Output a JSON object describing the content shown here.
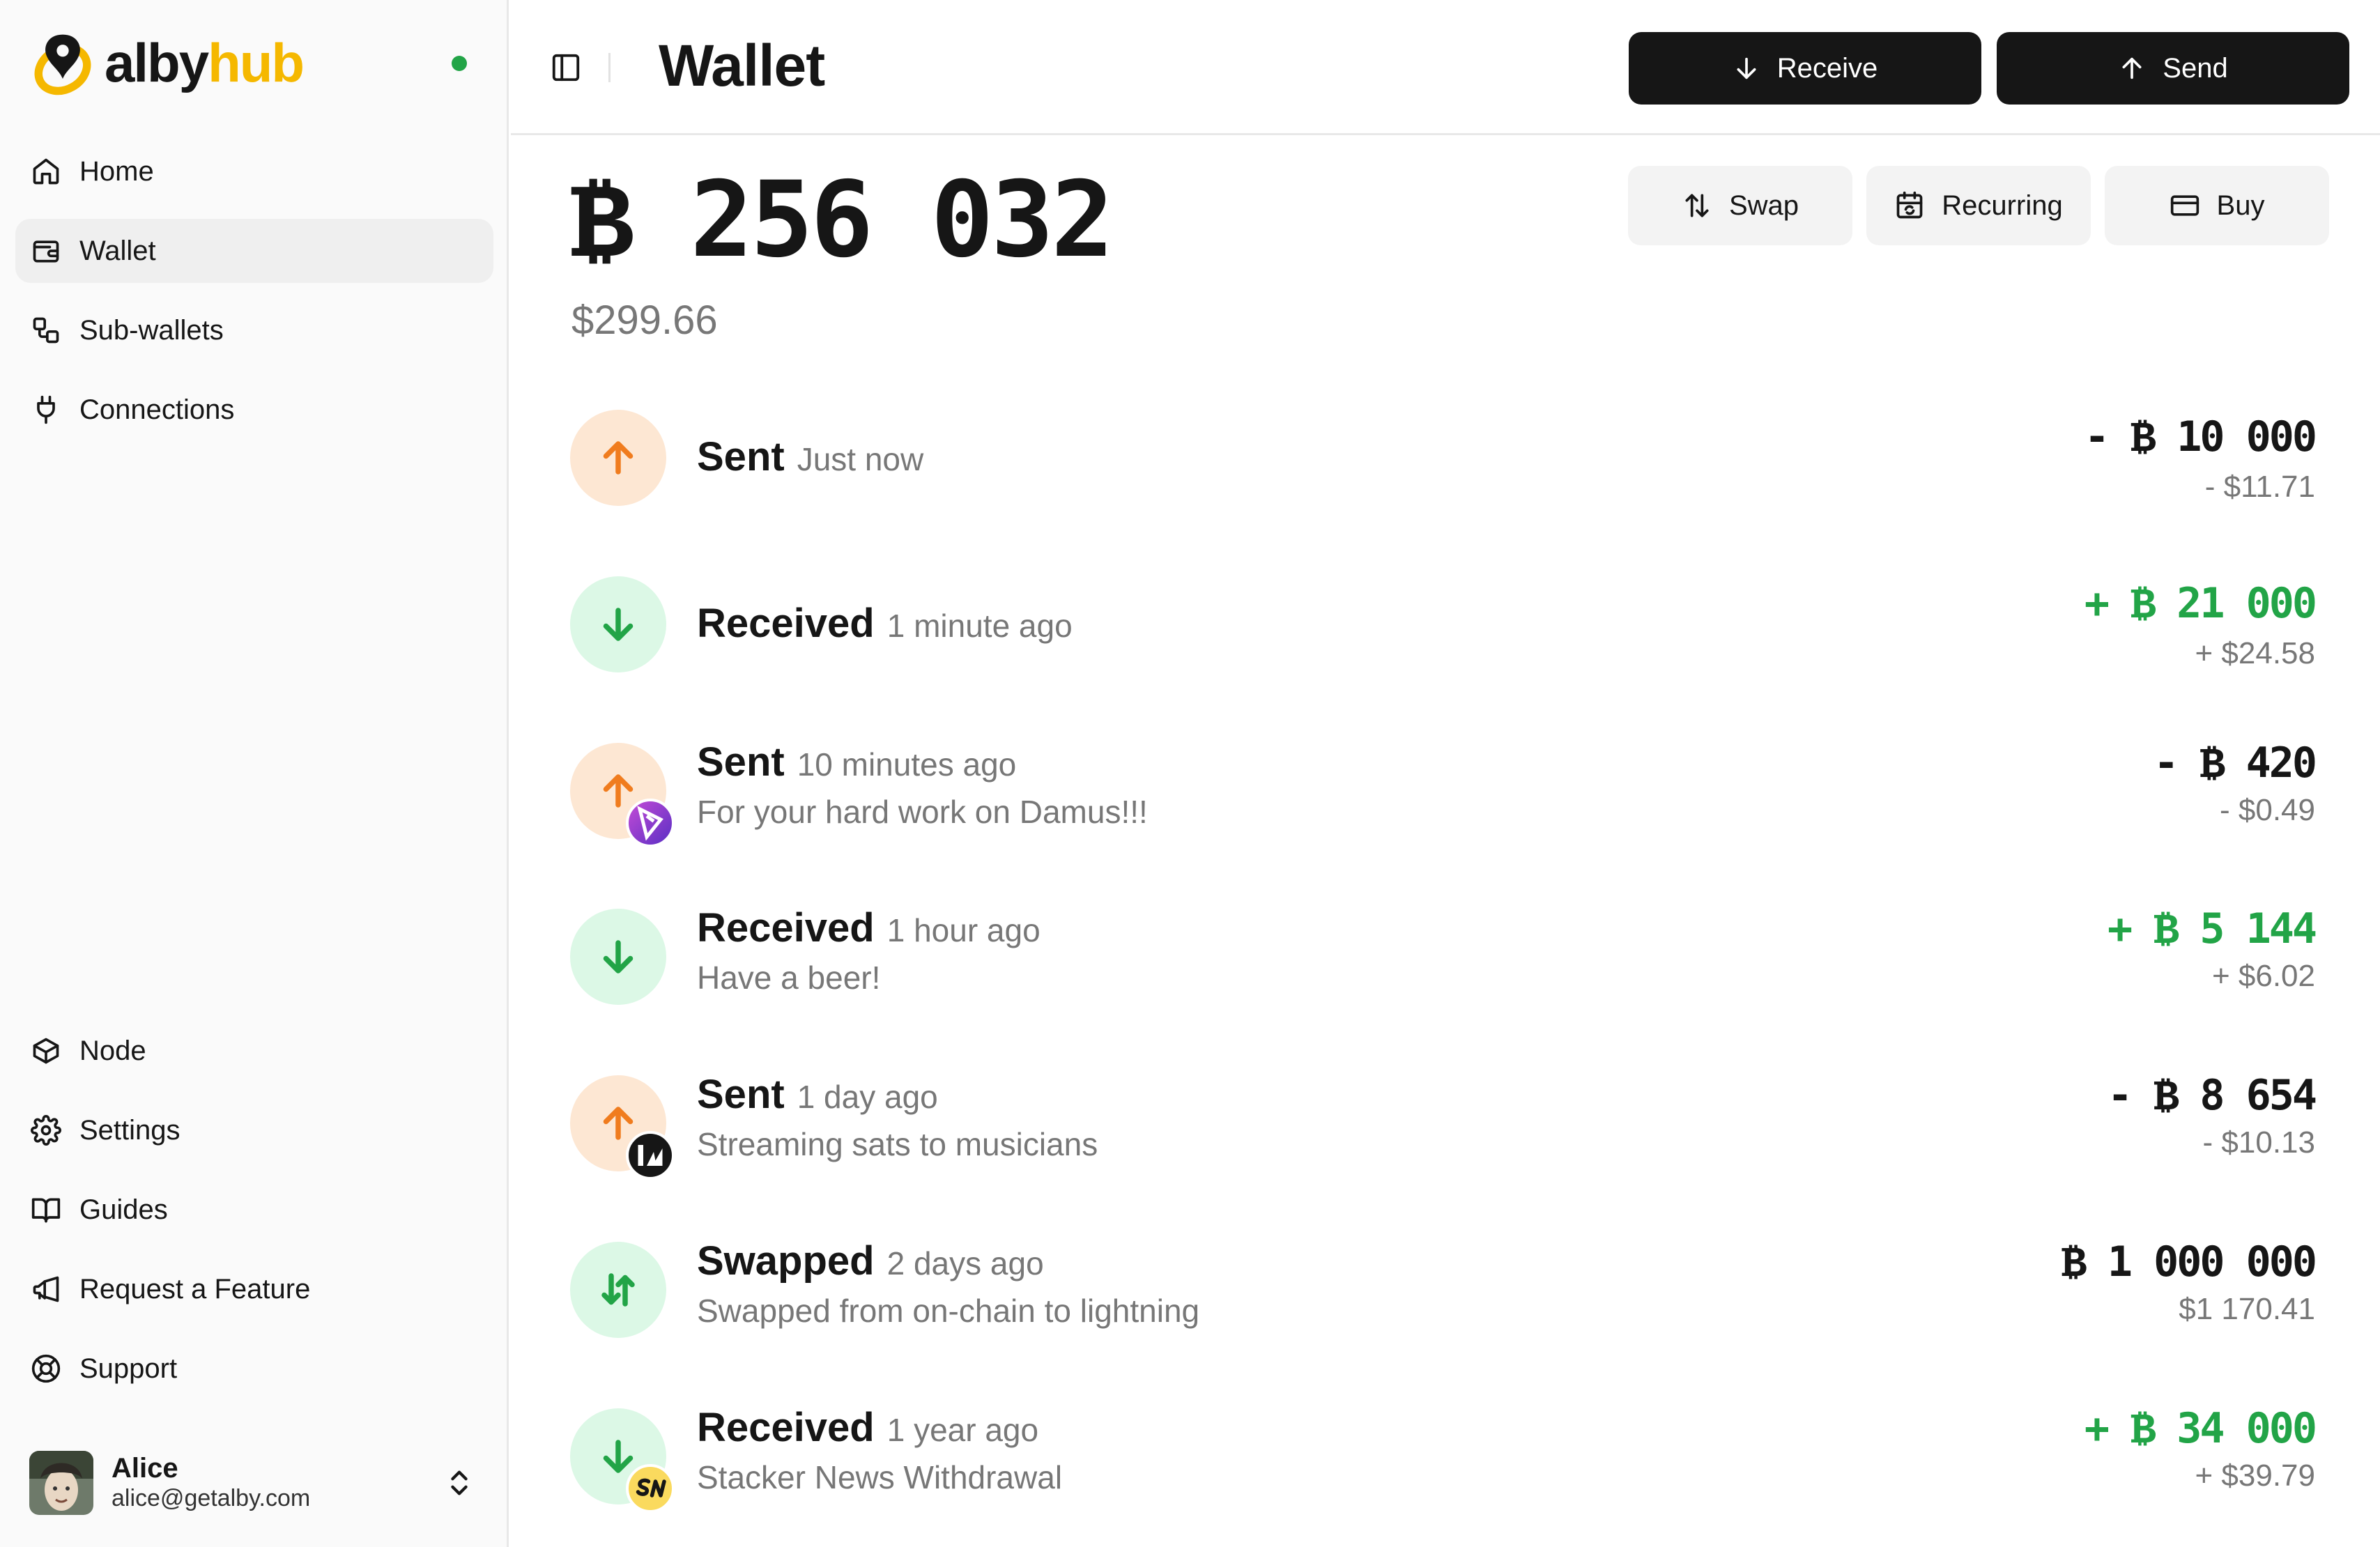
{
  "app": {
    "brand_part1": "alby",
    "brand_part2": "hub"
  },
  "colors": {
    "brand": "#f5b800",
    "positive": "#22a447",
    "sent_bg": "#fde7d3",
    "received_bg": "#dcf8e6",
    "sent_arrow": "#f07c1e"
  },
  "sidebar": {
    "top_items": [
      {
        "label": "Home",
        "icon": "home-icon"
      },
      {
        "label": "Wallet",
        "icon": "wallet-icon",
        "active": true
      },
      {
        "label": "Sub-wallets",
        "icon": "sub-wallets-icon"
      },
      {
        "label": "Connections",
        "icon": "plug-icon"
      }
    ],
    "bottom_items": [
      {
        "label": "Node",
        "icon": "box-icon"
      },
      {
        "label": "Settings",
        "icon": "gear-icon"
      },
      {
        "label": "Guides",
        "icon": "book-icon"
      },
      {
        "label": "Request a Feature",
        "icon": "megaphone-icon"
      },
      {
        "label": "Support",
        "icon": "lifebuoy-icon"
      }
    ],
    "user": {
      "name": "Alice",
      "email": "alice@getalby.com"
    }
  },
  "header": {
    "title": "Wallet",
    "receive_label": "Receive",
    "send_label": "Send"
  },
  "balance": {
    "sats": "₿ 256 032",
    "fiat": "$299.66"
  },
  "actions": {
    "swap_label": "Swap",
    "recurring_label": "Recurring",
    "buy_label": "Buy"
  },
  "transactions": [
    {
      "type": "Sent",
      "time": "Just now",
      "description": "",
      "amount": "- ₿ 10 000",
      "fiat": "- $11.71",
      "direction": "sent"
    },
    {
      "type": "Received",
      "time": "1 minute ago",
      "description": "",
      "amount": "+ ₿ 21 000",
      "fiat": "+ $24.58",
      "direction": "received"
    },
    {
      "type": "Sent",
      "time": "10 minutes ago",
      "description": "For your hard work on Damus!!!",
      "amount": "- ₿ 420",
      "fiat": "- $0.49",
      "direction": "sent",
      "app_badge": "damus-icon"
    },
    {
      "type": "Received",
      "time": "1 hour ago",
      "description": "Have a beer!",
      "amount": "+ ₿ 5 144",
      "fiat": "+ $6.02",
      "direction": "received"
    },
    {
      "type": "Sent",
      "time": "1 day ago",
      "description": "Streaming sats to musicians",
      "amount": "- ₿ 8 654",
      "fiat": "- $10.13",
      "direction": "sent",
      "app_badge": "wavlake-icon"
    },
    {
      "type": "Swapped",
      "time": "2 days ago",
      "description": "Swapped from on-chain to lightning",
      "amount": "₿ 1 000 000",
      "fiat": "$1 170.41",
      "direction": "swapped"
    },
    {
      "type": "Received",
      "time": "1 year ago",
      "description": "Stacker News Withdrawal",
      "amount": "+ ₿ 34 000",
      "fiat": "+ $39.79",
      "direction": "received",
      "app_badge": "stacker-news-icon"
    }
  ]
}
